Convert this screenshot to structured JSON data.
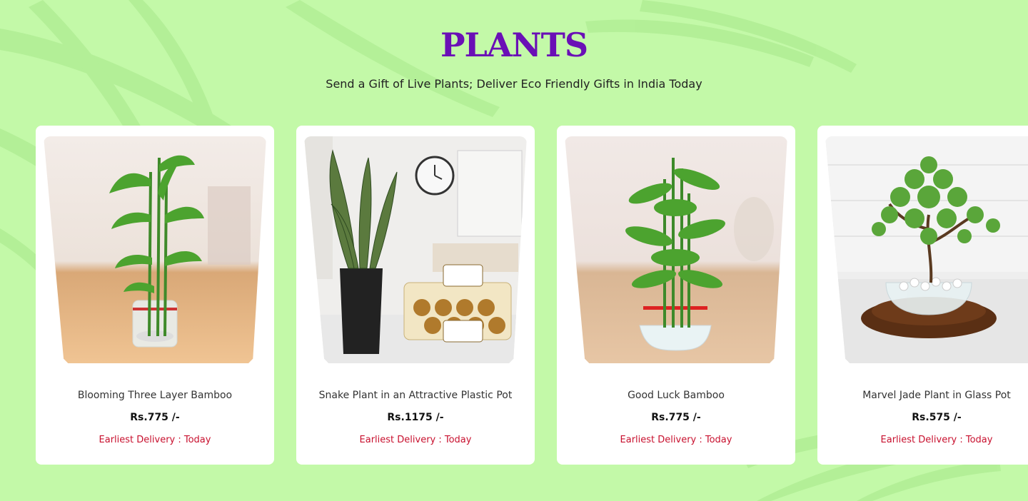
{
  "section": {
    "title": "PLANTS",
    "subtitle": "Send a Gift of Live Plants; Deliver Eco Friendly Gifts in India Today"
  },
  "colors": {
    "background": "#c3f9a8",
    "title": "#6a0fb6",
    "delivery": "#c8102e"
  },
  "products": [
    {
      "name": "Blooming Three Layer Bamboo",
      "price": "Rs.775 /-",
      "delivery": "Earliest Delivery : Today",
      "image": "bamboo-in-glass-image"
    },
    {
      "name": "Snake Plant in an Attractive Plastic Pot",
      "price": "Rs.1175 /-",
      "delivery": "Earliest Delivery : Today",
      "image": "snake-plant-with-chocolates-image"
    },
    {
      "name": "Good Luck Bamboo",
      "price": "Rs.775 /-",
      "delivery": "Earliest Delivery : Today",
      "image": "bamboo-bowl-image"
    },
    {
      "name": "Marvel Jade Plant in Glass Pot",
      "price": "Rs.575 /-",
      "delivery": "Earliest Delivery : Today",
      "image": "jade-plant-image"
    }
  ]
}
